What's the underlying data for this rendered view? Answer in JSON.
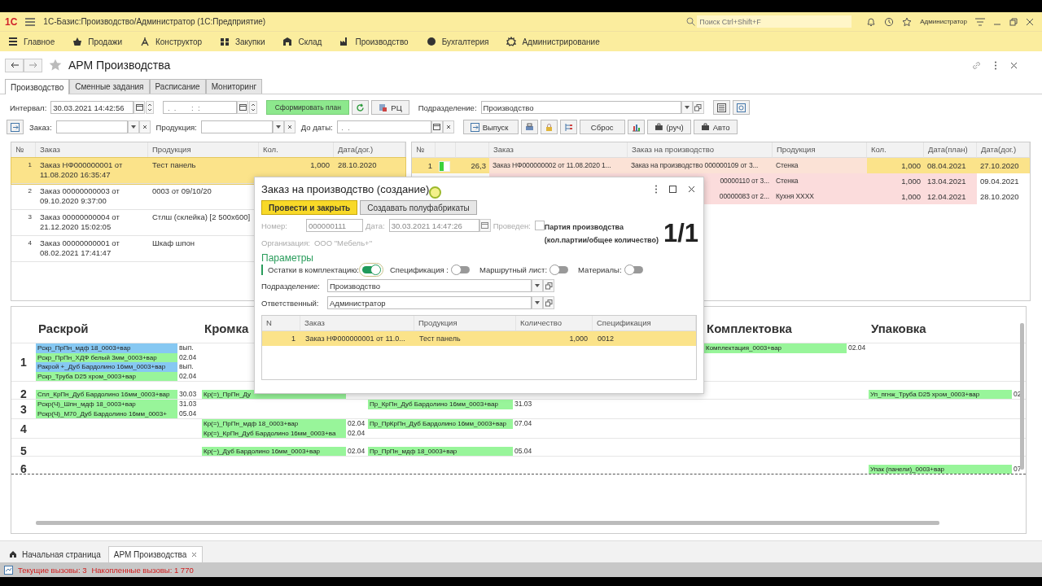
{
  "title_bar": {
    "logo": "1С",
    "title": "1С-Базис:Производство/Администратор  (1С:Предприятие)",
    "search": {
      "placeholder": "Поиск Ctrl+Shift+F"
    },
    "user": "Администратор"
  },
  "nav": [
    {
      "label": "Главное"
    },
    {
      "label": "Продажи"
    },
    {
      "label": "Конструктор"
    },
    {
      "label": "Закупки"
    },
    {
      "label": "Склад"
    },
    {
      "label": "Производство"
    },
    {
      "label": "Бухгалтерия"
    },
    {
      "label": "Администрирование"
    }
  ],
  "page": {
    "title": "АРМ Производства"
  },
  "tabs": [
    {
      "label": "Производство",
      "selected": true
    },
    {
      "label": "Сменные задания",
      "selected": false
    },
    {
      "label": "Расписание",
      "selected": false
    },
    {
      "label": "Мониторинг",
      "selected": false
    }
  ],
  "toolbar": {
    "interval_label": "Интервал:",
    "interval_from": "30.03.2021 14:42:56",
    "interval_to_placeholder": " .  .       :  :",
    "build_button": "Сформировать план",
    "rc_button": "РЦ",
    "division_label": "Подразделение:",
    "division_value": "Производство",
    "order_label": "Заказ:",
    "product_label": "Продукция:",
    "until_label": "До даты:",
    "until_placeholder": " .  .",
    "release_button": "Выпуск",
    "reset_button": "Сброс",
    "manual_button": "(руч)",
    "auto_button": "Авто"
  },
  "orders": {
    "columns": [
      "№",
      "Заказ",
      "Продукция",
      "Кол.",
      "Дата(дог.)"
    ],
    "rows": [
      {
        "n": "1",
        "order": "Заказ НФ000000001 от 11.08.2020 16:35:47",
        "product": "Тест панель",
        "qty": "1,000",
        "date": "28.10.2020",
        "selected": true
      },
      {
        "n": "2",
        "order": "Заказ 00000000003 от 09.10.2020 9:37:00",
        "product": "0003 от 09/10/20",
        "selected": false
      },
      {
        "n": "3",
        "order": "Заказ 00000000004 от 21.12.2020 15:02:05",
        "product": "Стлш (склейка) [2 500x600]",
        "selected": false
      },
      {
        "n": "4",
        "order": "Заказ 00000000001 от 08.02.2021 17:41:47",
        "product": "Шкаф шпон",
        "selected": false
      }
    ]
  },
  "jobs": {
    "columns": [
      "№",
      "Заказ",
      "Заказ на производство",
      "Продукция",
      "Кол.",
      "Дата(план)",
      "Дата(дог.)"
    ],
    "rows": [
      {
        "n": "1",
        "level": 0.4,
        "value": "26,3",
        "order": "Заказ НФ000000002 от 11.08.2020 1...",
        "prod_order": "Заказ на производство 000000109 от 3...",
        "product": "Стенка",
        "qty": "1,000",
        "plan_date": "08.04.2021",
        "contract_date": "27.10.2020",
        "selected": true,
        "overdue": true
      },
      {
        "prod_order": "00000110 от 3...",
        "product": "Стенка",
        "qty": "1,000",
        "plan_date": "13.04.2021",
        "contract_date": "09.04.2021",
        "selected": false,
        "overdue": true
      },
      {
        "prod_order": "00000083 от 2...",
        "product": "Кухня XXXX",
        "qty": "1,000",
        "plan_date": "12.04.2021",
        "contract_date": "28.10.2020",
        "selected": false,
        "overdue": true
      }
    ]
  },
  "plan": {
    "headers": [
      {
        "kind": "raskroy",
        "label": "Раскрой"
      },
      {
        "kind": "kromka",
        "label": "Кромка"
      },
      {
        "kind": "komplektovka",
        "label": "Комплектовка"
      },
      {
        "kind": "upakovka",
        "label": "Упаковка"
      }
    ],
    "groups": [
      {
        "number": "1",
        "lines": [
          [
            {
              "kind": "raskroy",
              "text": "Рскр_ПрПн_мдф 18_0003+вар",
              "date": "вып.",
              "color": "#86c8f2"
            },
            {
              "kind": "komplektovka",
              "text": "Комплектация_0003+вар",
              "date": "02.04",
              "color": "#98f59a"
            }
          ],
          [
            {
              "kind": "raskroy",
              "text": "Рскр_ПрПн_ХДФ белый 3мм_0003+вар",
              "date": "02.04",
              "color": "#98f59a"
            }
          ],
          [
            {
              "kind": "raskroy",
              "text": "Ракрой +_Дуб Бардолино 16мм_0003+вар",
              "date": "вып.",
              "color": "#86c8f2"
            }
          ],
          [
            {
              "kind": "raskroy",
              "text": "Рскр_Труба D25 хром_0003+вар",
              "date": "02.04",
              "color": "#98f59a"
            }
          ]
        ]
      },
      {
        "number": "2",
        "lines": [
          [
            {
              "kind": "raskroy",
              "text": "Спл_КрПн_Дуб Бардолино 16мм_0003+вар",
              "date": "30.03",
              "color": "#98f59a"
            },
            {
              "kind": "kromka",
              "text": "Кр(=)_ПрПн_Ду",
              "color": "#98f59a"
            },
            {
              "kind": "upakovka",
              "text": "Уп_пгнж_Труба D25 хром_0003+вар",
              "date": "02",
              "color": "#98f59a"
            }
          ]
        ]
      },
      {
        "number": "3",
        "lines": [
          [
            {
              "kind": "raskroy",
              "text": "Рскр(Ч)_Шпн_мдф 18_0003+вар",
              "date": "31.03",
              "color": "#98f59a"
            },
            {
              "kind": "stage3",
              "text": "Пр_КрПн_Дуб Бардолино 16мм_0003+вар",
              "date": "31.03",
              "color": "#98f59a"
            }
          ],
          [
            {
              "kind": "raskroy",
              "text": "Рскр(Ч)_М70_Дуб Бардолино 16мм_0003+",
              "date": "05.04",
              "color": "#98f59a"
            }
          ]
        ]
      },
      {
        "number": "4",
        "lines": [
          [
            {
              "kind": "kromka",
              "text": "Кр(=)_ПрПн_мдф 18_0003+вар",
              "date": "02.04",
              "color": "#98f59a"
            },
            {
              "kind": "stage3",
              "text": "Пр_ПрКрПн_Дуб Бардолино 16мм_0003+вар",
              "date": "07.04",
              "color": "#98f59a"
            }
          ],
          [
            {
              "kind": "kromka",
              "text": "Кр(=)_КрПн_Дуб Бардолино 16мм_0003+ва",
              "date": "02.04",
              "color": "#98f59a"
            }
          ]
        ]
      },
      {
        "number": "5",
        "lines": [
          [
            {
              "kind": "kromka",
              "text": "Кр(~)_Дуб Бардолино 16мм_0003+вар",
              "date": "02.04",
              "color": "#98f59a"
            },
            {
              "kind": "stage3",
              "text": "Пр_ПрПн_мдф 18_0003+вар",
              "date": "05.04",
              "color": "#98f59a"
            }
          ]
        ]
      },
      {
        "number": "6",
        "lines": [
          [
            {
              "kind": "upakovka",
              "text": "Упак (панели)_0003+вар",
              "date": "07",
              "color": "#98f59a"
            }
          ]
        ]
      }
    ]
  },
  "dialog": {
    "title": "Заказ на производство (создание)",
    "post_button": "Провести и закрыть",
    "semi_button": "Создавать полуфабрикаты",
    "number_label": "Номер:",
    "number": "000000111",
    "date_label": "Дата:",
    "date": "30.03.2021 14:47:26",
    "posted_label": "Проведен:",
    "posted": false,
    "batch_title": "Партия производства",
    "batch_hint": "(кол.партии/общее количество)",
    "batch_value": "1/1",
    "org_label": "Организация:",
    "org": "ООО \"Мебель+\"",
    "params_title": "Параметры",
    "switches": [
      {
        "label": "Остатки в комплектацию:",
        "on": true
      },
      {
        "label": "Спецификация :",
        "on": false
      },
      {
        "label": "Маршрутный лист:",
        "on": false
      },
      {
        "label": "Материалы:",
        "on": false
      }
    ],
    "division_label": "Подразделение:",
    "division": "Производство",
    "responsible_label": "Ответственный:",
    "responsible": "Администратор",
    "table": {
      "columns": [
        "N",
        "Заказ",
        "Продукция",
        "Количество",
        "Спецификация"
      ],
      "rows": [
        {
          "n": "1",
          "order": "Заказ НФ000000001 от 11.0...",
          "product": "Тест панель",
          "qty": "1,000",
          "spec": "0012",
          "selected": true
        }
      ]
    }
  },
  "open_tabs": [
    {
      "label": "Начальная страница",
      "selected": false
    },
    {
      "label": "АРМ Производства",
      "selected": true
    }
  ],
  "status": {
    "current": "Текущие вызовы: 3",
    "accumulated": "Накопленные вызовы: 1 770"
  }
}
